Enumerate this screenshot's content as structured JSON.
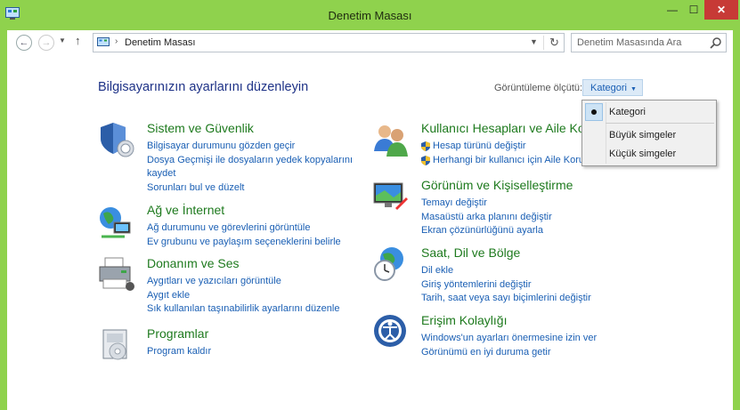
{
  "window": {
    "title": "Denetim Masası",
    "minimize": "—",
    "maximize": "☐",
    "close": "✕"
  },
  "address": {
    "path": "Denetim Masası",
    "search_placeholder": "Denetim Masasında Ara"
  },
  "heading": "Bilgisayarınızın ayarlarını düzenleyin",
  "view": {
    "label": "Görüntüleme ölçütü:",
    "selected": "Kategori",
    "options": [
      "Kategori",
      "Büyük simgeler",
      "Küçük simgeler"
    ]
  },
  "categories": [
    {
      "title": "Sistem ve Güvenlik",
      "icon": "shield-icon",
      "links": [
        "Bilgisayar durumunu gözden geçir",
        "Dosya Geçmişi ile dosyaların yedek kopyalarını",
        "kaydet",
        "Sorunları bul ve düzelt"
      ]
    },
    {
      "title": "Ağ ve İnternet",
      "icon": "network-icon",
      "links": [
        "Ağ durumunu ve görevlerini görüntüle",
        "Ev grubunu ve paylaşım seçeneklerini belirle"
      ]
    },
    {
      "title": "Donanım ve Ses",
      "icon": "printer-icon",
      "links": [
        "Aygıtları ve yazıcıları görüntüle",
        "Aygıt ekle",
        "Sık kullanılan taşınabilirlik ayarlarını düzenle"
      ]
    },
    {
      "title": "Programlar",
      "icon": "programs-icon",
      "links": [
        "Program kaldır"
      ]
    },
    {
      "title": "Kullanıcı Hesapları ve Aile Korumas",
      "icon": "users-icon",
      "links": [
        "Hesap türünü değiştir",
        "Herhangi bir kullanıcı için Aile Korumas"
      ]
    },
    {
      "title": "Görünüm ve Kişiselleştirme",
      "icon": "appearance-icon",
      "links": [
        "Temayı değiştir",
        "Masaüstü arka planını değiştir",
        "Ekran çözünürlüğünü ayarla"
      ]
    },
    {
      "title": "Saat, Dil ve Bölge",
      "icon": "clock-globe-icon",
      "links": [
        "Dil ekle",
        "Giriş yöntemlerini değiştir",
        "Tarih, saat veya sayı biçimlerini değiştir"
      ]
    },
    {
      "title": "Erişim Kolaylığı",
      "icon": "accessibility-icon",
      "links": [
        "Windows'un ayarları önermesine izin ver",
        "Görünümü en iyi duruma getir"
      ]
    }
  ]
}
